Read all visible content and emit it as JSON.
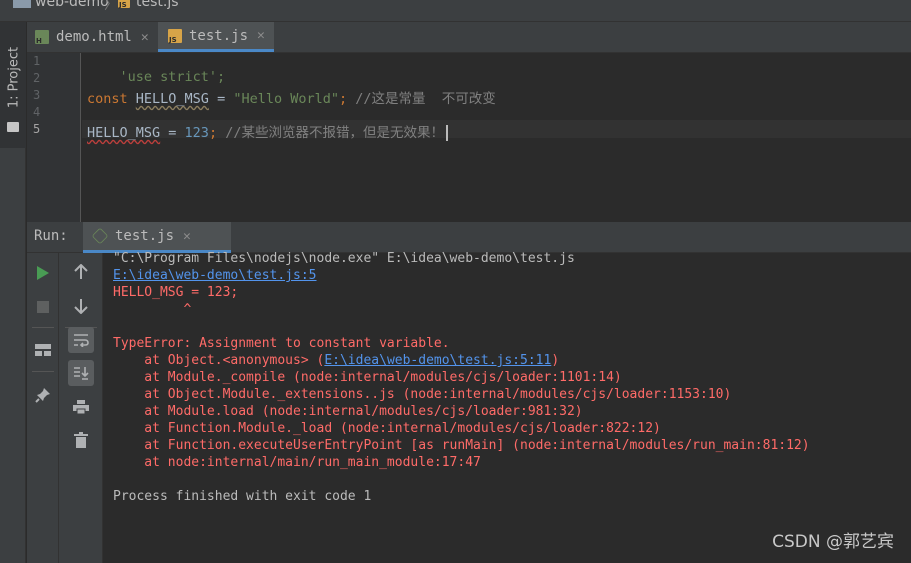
{
  "breadcrumb": {
    "project": "web-demo",
    "separator": "〉",
    "file": "test.js"
  },
  "sidebar": {
    "project_tab": "1: Project"
  },
  "editor": {
    "tabs": [
      {
        "label": "demo.html",
        "icon": "html-file-icon",
        "close": "✕"
      },
      {
        "label": "test.js",
        "icon": "js-file-icon",
        "close": "✕",
        "active": true
      }
    ],
    "line_numbers": [
      "1",
      "2",
      "3",
      "4",
      "5"
    ],
    "lines": {
      "l1": {
        "str": "'use strict';"
      },
      "l3": {
        "kw": "const",
        "ident": "HELLO_MSG",
        "op": " = ",
        "str": "\"Hello World\"",
        "semi": ";",
        "cmt": " //这是常量  不可改变"
      },
      "l5": {
        "ident": "HELLO_MSG",
        "op": " = ",
        "num": "123",
        "semi": ";",
        "cmt": " //某些浏览器不报错，但是无效果！"
      }
    }
  },
  "run": {
    "label": "Run:",
    "tab_label": "test.js",
    "tab_close": "✕",
    "toolbar_icons": [
      "run-icon",
      "stop-icon",
      "layout-icon",
      "pin-icon",
      "up-arrow-icon",
      "down-arrow-icon",
      "soft-wrap-icon",
      "scroll-to-end-icon",
      "print-icon",
      "trash-icon"
    ]
  },
  "console": {
    "cmd": "\"C:\\Program Files\\nodejs\\node.exe\" E:\\idea\\web-demo\\test.js",
    "loc_link": "E:\\idea\\web-demo\\test.js:5",
    "src_line": "HELLO_MSG = 123;",
    "caret": "         ^",
    "error": "TypeError: Assignment to constant variable.",
    "stack1_pre": "    at Object.<anonymous> (",
    "stack1_link": "E:\\idea\\web-demo\\test.js:5:11",
    "stack1_post": ")",
    "stack2": "    at Module._compile (node:internal/modules/cjs/loader:1101:14)",
    "stack3": "    at Object.Module._extensions..js (node:internal/modules/cjs/loader:1153:10)",
    "stack4": "    at Module.load (node:internal/modules/cjs/loader:981:32)",
    "stack5": "    at Function.Module._load (node:internal/modules/cjs/loader:822:12)",
    "stack6": "    at Function.executeUserEntryPoint [as runMain] (node:internal/modules/run_main:81:12)",
    "stack7": "    at node:internal/main/run_main_module:17:47",
    "exit": "Process finished with exit code 1"
  },
  "watermark": "CSDN @郭艺宾",
  "colors": {
    "background": "#2b2b2b",
    "panel": "#3c3f41",
    "string": "#6a8759",
    "keyword": "#cc7832",
    "number": "#6897bb",
    "comment": "#808080",
    "error_text": "#ff6b68",
    "link": "#5394ec",
    "accent": "#4a88c7"
  }
}
